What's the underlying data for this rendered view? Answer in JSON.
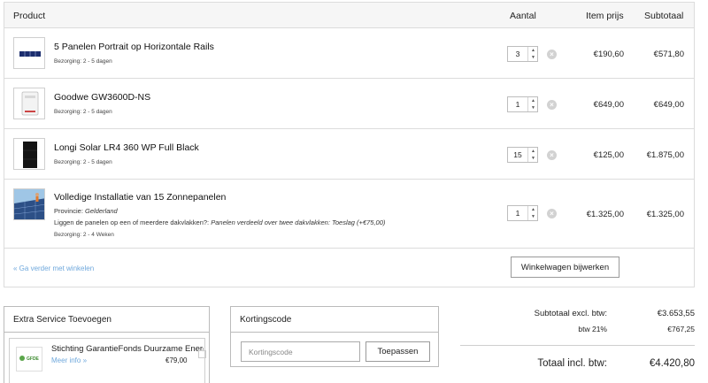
{
  "cart": {
    "headers": {
      "product": "Product",
      "quantity": "Aantal",
      "item_price": "Item prijs",
      "subtotal": "Subtotaal"
    },
    "items": [
      {
        "name": "5 Panelen Portrait op Horizontale Rails",
        "delivery": "Bezorging: 2 - 5 dagen",
        "quantity": "3",
        "price": "€190,60",
        "subtotal": "€571,80"
      },
      {
        "name": "Goodwe GW3600D-NS",
        "delivery": "Bezorging: 2 - 5 dagen",
        "quantity": "1",
        "price": "€649,00",
        "subtotal": "€649,00"
      },
      {
        "name": "Longi Solar LR4 360 WP Full Black",
        "delivery": "Bezorging: 2 - 5 dagen",
        "quantity": "15",
        "price": "€125,00",
        "subtotal": "€1.875,00"
      },
      {
        "name": "Volledige Installatie van 15 Zonnepanelen",
        "province_label": "Provincie:",
        "province_value": "Gelderland",
        "option_label": "Liggen de panelen op een of meerdere dakvlakken?:",
        "option_value": "Panelen verdeeld over twee dakvlakken: Toeslag (+€75,00)",
        "delivery": "Bezorging: 2 - 4 Weken",
        "quantity": "1",
        "price": "€1.325,00",
        "subtotal": "€1.325,00"
      }
    ],
    "continue_link": "« Ga verder met winkelen",
    "update_button": "Winkelwagen bijwerken"
  },
  "extra_service": {
    "title": "Extra Service Toevoegen",
    "item_name": "Stichting GarantieFonds Duurzame Energie",
    "logo_text": "GFDE",
    "more_link": "Meer info »",
    "price": "€79,00"
  },
  "coupon": {
    "title": "Kortingscode",
    "placeholder": "Kortingscode",
    "apply_button": "Toepassen"
  },
  "totals": {
    "subtotal_label": "Subtotaal excl. btw:",
    "subtotal_value": "€3.653,55",
    "vat_label": "btw 21%",
    "vat_value": "€767,25",
    "total_label": "Totaal incl. btw:",
    "total_value": "€4.420,80"
  },
  "colors": {
    "link": "#6fa8dc",
    "border": "#dcdcdc",
    "header_bg": "#f6f6f6",
    "remove_icon": "#d2d2d2"
  }
}
